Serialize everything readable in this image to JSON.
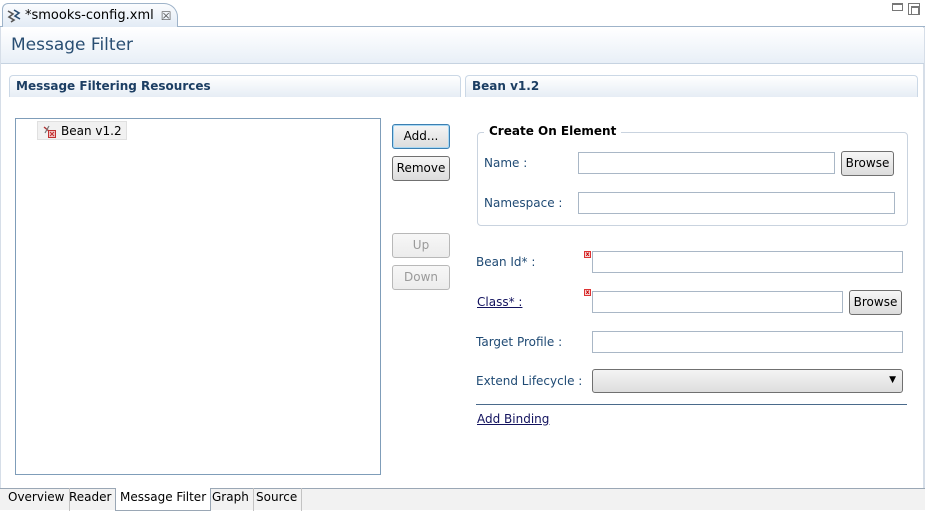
{
  "editor": {
    "tab_title": "*smooks-config.xml",
    "close_glyph": "☒",
    "icon": "smooks-file-icon"
  },
  "form": {
    "title": "Message Filter"
  },
  "left_section": {
    "title": "Message Filtering Resources",
    "tree_items": [
      {
        "label": "Bean v1.2",
        "icon": "bean-icon"
      }
    ],
    "buttons": {
      "add": "Add...",
      "remove": "Remove",
      "up": "Up",
      "down": "Down"
    }
  },
  "right_section": {
    "title": "Bean v1.2",
    "create_group": {
      "title": "Create On Element",
      "name_label": "Name :",
      "name_value": "",
      "browse_label": "Browse",
      "namespace_label": "Namespace :",
      "namespace_value": ""
    },
    "bean_id_label": "Bean Id* :",
    "bean_id_value": "",
    "class_label": "Class* :",
    "class_value": "",
    "class_browse_label": "Browse",
    "target_profile_label": "Target Profile :",
    "target_profile_value": "",
    "extend_lifecycle_label": "Extend Lifecycle :",
    "extend_lifecycle_value": "",
    "add_binding_label": "Add Binding"
  },
  "bottom_tabs": [
    "Overview",
    "Reader",
    "Message Filter",
    "Graph",
    "Source"
  ],
  "active_tab": "Message Filter",
  "colors": {
    "section_title": "#1c3e63",
    "form_title": "#294e72",
    "label": "#1f4a74",
    "error": "#dd3333"
  }
}
